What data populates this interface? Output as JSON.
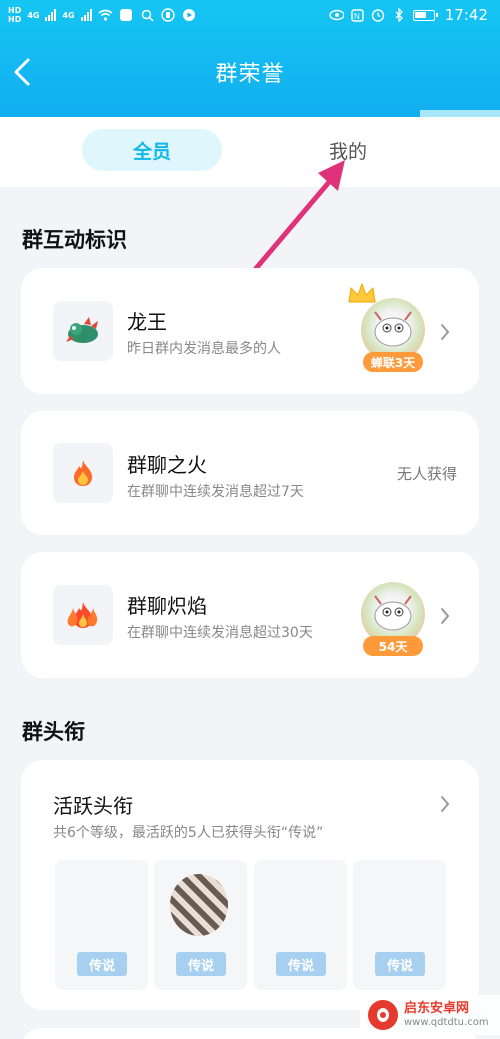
{
  "status_bar": {
    "hd1": "HD",
    "hd2": "HD",
    "net1": "4G",
    "net2": "4G",
    "time": "17:42",
    "icons": [
      "signal-icon",
      "wifi-icon",
      "eye-icon",
      "nfc-icon",
      "alarm-icon",
      "bluetooth-icon",
      "battery-icon"
    ]
  },
  "header": {
    "title": "群荣誉",
    "back_icon": "chevron-left-icon"
  },
  "tabs": {
    "all": "全员",
    "mine": "我的"
  },
  "interaction_badges": {
    "section_title": "群互动标识",
    "items": [
      {
        "name": "龙王",
        "desc": "昨日群内发消息最多的人",
        "icon": "dragon-icon",
        "holder_badge": "蝉联3天"
      },
      {
        "name": "群聊之火",
        "desc": "在群聊中连续发消息超过7天",
        "icon": "fire-icon",
        "status": "无人获得"
      },
      {
        "name": "群聊炽焰",
        "desc": "在群聊中连续发消息超过30天",
        "icon": "blaze-icon",
        "holder_badge": "54天"
      }
    ]
  },
  "group_titles": {
    "section_title": "群头衔",
    "card_title": "活跃头衔",
    "card_desc": "共6个等级，最活跃的5人已获得头衔“传说”",
    "slots": [
      {
        "label": "传说"
      },
      {
        "label": "传说"
      },
      {
        "label": "传说"
      },
      {
        "label": "传说"
      }
    ]
  },
  "watermark": {
    "title": "启东安卓网",
    "url": "www.qdtdtu.com"
  },
  "colors": {
    "header_top": "#15c6f2",
    "header_bottom": "#12aef0",
    "tab_active_text": "#12b7ea",
    "tab_active_bg": "#dff6fd",
    "badge_orange": "#ff9a3a",
    "slot_label": "#a6cff0",
    "annotation_arrow": "#e0327a"
  }
}
